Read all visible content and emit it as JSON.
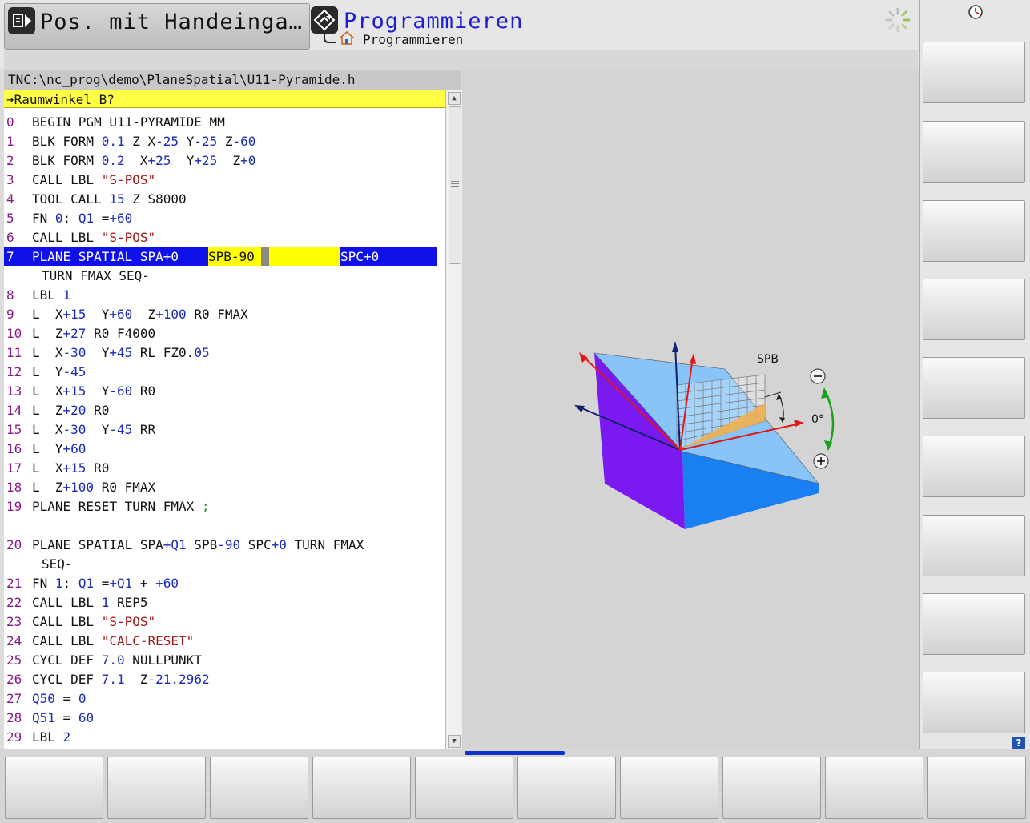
{
  "header": {
    "tab_mode": "Pos. mit Handeinga…",
    "tab_program": "Programmieren",
    "sub_program": "Programmieren"
  },
  "editor": {
    "path": "TNC:\\nc_prog\\demo\\PlaneSpatial\\U11-Pyramide.h",
    "prompt": "➔Raumwinkel B?",
    "selected_line": {
      "num": "7",
      "part1": "PLANE SPATIAL SPA+0 ",
      "part2": "SPB-90",
      "part3": "SPC+0",
      "continuation": "TURN FMAX SEQ-"
    },
    "lines": [
      {
        "num": "0",
        "code": "BEGIN PGM U11-PYRAMIDE MM"
      },
      {
        "num": "1",
        "code": "BLK FORM 0.1 Z X-25 Y-25 Z-60"
      },
      {
        "num": "2",
        "code": "BLK FORM 0.2  X+25  Y+25  Z+0"
      },
      {
        "num": "3",
        "code": "CALL LBL \"S-POS\""
      },
      {
        "num": "4",
        "code": "TOOL CALL 15 Z S8000"
      },
      {
        "num": "5",
        "code": "FN 0: Q1 =+60"
      },
      {
        "num": "6",
        "code": "CALL LBL \"S-POS\""
      },
      {
        "num": "8",
        "code": "LBL 1"
      },
      {
        "num": "9",
        "code": "L  X+15  Y+60  Z+100 R0 FMAX"
      },
      {
        "num": "10",
        "code": "L  Z+27 R0 F4000"
      },
      {
        "num": "11",
        "code": "L  X-30  Y+45 RL FZ0.05"
      },
      {
        "num": "12",
        "code": "L  Y-45"
      },
      {
        "num": "13",
        "code": "L  X+15  Y-60 R0"
      },
      {
        "num": "14",
        "code": "L  Z+20 R0"
      },
      {
        "num": "15",
        "code": "L  X-30  Y-45 RR"
      },
      {
        "num": "16",
        "code": "L  Y+60"
      },
      {
        "num": "17",
        "code": "L  X+15 R0"
      },
      {
        "num": "18",
        "code": "L  Z+100 R0 FMAX"
      },
      {
        "num": "19",
        "code": "PLANE RESET TURN FMAX ;"
      },
      {
        "num": "20",
        "code": "PLANE SPATIAL SPA+Q1 SPB-90 SPC+0 TURN FMAX"
      },
      {
        "num": "",
        "code": "SEQ-"
      },
      {
        "num": "21",
        "code": "FN 1: Q1 =+Q1 + +60"
      },
      {
        "num": "22",
        "code": "CALL LBL 1 REP5"
      },
      {
        "num": "23",
        "code": "CALL LBL \"S-POS\""
      },
      {
        "num": "24",
        "code": "CALL LBL \"CALC-RESET\""
      },
      {
        "num": "25",
        "code": "CYCL DEF 7.0 NULLPUNKT"
      },
      {
        "num": "26",
        "code": "CYCL DEF 7.1  Z-21.2962"
      },
      {
        "num": "27",
        "code": "Q50 = 0"
      },
      {
        "num": "28",
        "code": "Q51 = 60"
      },
      {
        "num": "29",
        "code": "LBL 2"
      }
    ]
  },
  "graphic": {
    "label_axis": "SPB",
    "label_angle": "0°",
    "zoom_minus": "−",
    "zoom_plus": "+"
  },
  "right": {
    "help": "?"
  },
  "colors": {
    "accent_blue": "#1010e8",
    "highlight_yellow": "#ffff00",
    "prompt_yellow": "#ffff44"
  }
}
